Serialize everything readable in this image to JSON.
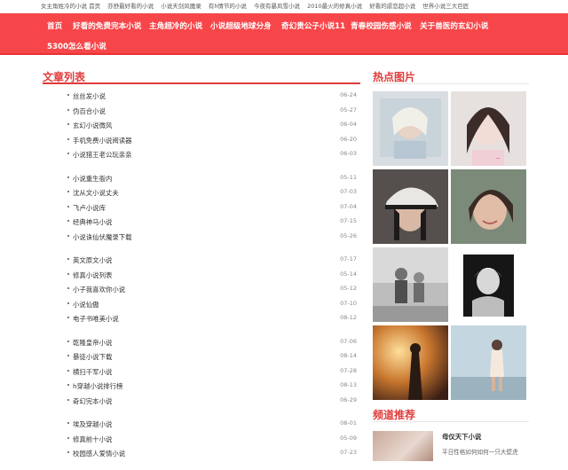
{
  "top_links": [
    "女主角姓冷的小说 首页",
    "亦舒最好看的小说",
    "小说天剑风魔录",
    "有h情节的小说",
    "今夜有暴风雪小说",
    "2010最火的修真小说",
    "好看的虐恋超小说",
    "世界小说三大巨匠"
  ],
  "nav": [
    "首页",
    "好看的免费完本小说",
    "主角超冷的小说",
    "小说超级地球分身",
    "奇幻贵公子小说11",
    "青春校园伤感小说",
    "关于兽医的玄幻小说",
    "5300怎么看小说"
  ],
  "articles": {
    "title": "文章列表",
    "groups": [
      [
        {
          "title": "丝丝发小说",
          "date": "06-24"
        },
        {
          "title": "伪百合小说",
          "date": "05-27"
        },
        {
          "title": "玄幻小说微风",
          "date": "06-04"
        },
        {
          "title": "手机免费小说阅读器",
          "date": "06-20"
        },
        {
          "title": "小说猎王老公玩亲亲",
          "date": "06-03"
        }
      ],
      [
        {
          "title": "小说重生衙内",
          "date": "05-11"
        },
        {
          "title": "沈从文小说丈夫",
          "date": "07-03"
        },
        {
          "title": "飞卢小说库",
          "date": "07-04"
        },
        {
          "title": "经典神马小说",
          "date": "07-15"
        },
        {
          "title": "小说诛仙伏魔录下载",
          "date": "05-26"
        }
      ],
      [
        {
          "title": "英文原文小说",
          "date": "07-17"
        },
        {
          "title": "修真小说列表",
          "date": "05-14"
        },
        {
          "title": "小子我喜欢你小说",
          "date": "05-12"
        },
        {
          "title": "小说仙傲",
          "date": "07-10"
        },
        {
          "title": "电子书唯美小说",
          "date": "08-12"
        }
      ],
      [
        {
          "title": "乾隆皇帝小说",
          "date": "07-06"
        },
        {
          "title": "暴徒小说下载",
          "date": "08-14"
        },
        {
          "title": "横扫千军小说",
          "date": "07-28"
        },
        {
          "title": "h穿越小说排行榜",
          "date": "08-13"
        },
        {
          "title": "奇幻完本小说",
          "date": "06-29"
        }
      ],
      [
        {
          "title": "埃及穿越小说",
          "date": "08-01"
        },
        {
          "title": "修真前十小说",
          "date": "05-09"
        },
        {
          "title": "校园感人爱情小说",
          "date": "07-23"
        }
      ]
    ]
  },
  "hot_images": {
    "title": "热点图片",
    "tiles": [
      "girl-photo",
      "girl-selfie-photo",
      "girl-cap-photo",
      "smiling-woman-photo",
      "children-photo",
      "marilyn-portrait-photo",
      "sunset-couple-photo",
      "beach-woman-photo"
    ]
  },
  "channel": {
    "title": "频道推荐",
    "item_title": "母仪天下小说",
    "item_desc": "平日性格如何如何一只大壁虎"
  }
}
